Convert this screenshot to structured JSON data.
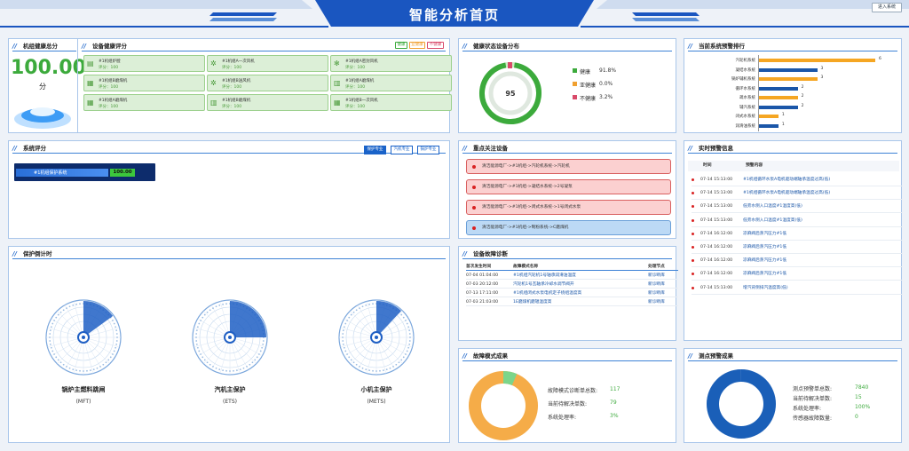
{
  "header": {
    "title": "智能分析首页",
    "button": "进入系统"
  },
  "health": {
    "title": "机组健康总分",
    "score": "100.00",
    "unit": "分"
  },
  "device": {
    "title": "设备健康评分",
    "legend": [
      {
        "label": "健康",
        "color": "#3caa3c"
      },
      {
        "label": "亚健康",
        "color": "#f0a030"
      },
      {
        "label": "不健康",
        "color": "#d94a6a"
      }
    ],
    "items": [
      {
        "name": "#1机组炉膛",
        "score": "评分：100"
      },
      {
        "name": "#1机组A一次风机",
        "score": "评分：100"
      },
      {
        "name": "#1机组A密封风机",
        "score": "评分：100"
      },
      {
        "name": "#1机组B磨煤机",
        "score": "评分：100"
      },
      {
        "name": "#1机组B送风机",
        "score": "评分：100"
      },
      {
        "name": "#1机组A磨煤机",
        "score": "评分：100"
      },
      {
        "name": "#1机组A磨煤机",
        "score": "评分：100"
      },
      {
        "name": "#1机组B磨煤机",
        "score": "评分：100"
      },
      {
        "name": "#1机组B一次风机",
        "score": "评分：100"
      }
    ]
  },
  "status_dist": {
    "title": "健康状态设备分布",
    "center": "95",
    "items": [
      {
        "label": "健康",
        "value": "91.8%",
        "color": "#3caa3c"
      },
      {
        "label": "亚健康",
        "value": "0.0%",
        "color": "#f0a030"
      },
      {
        "label": "不健康",
        "value": "3.2%",
        "color": "#d94a6a"
      }
    ]
  },
  "ranking": {
    "title": "当前系统预警排行",
    "items": [
      {
        "label": "汽轮机系统",
        "value": 6,
        "color": "#f5a623"
      },
      {
        "label": "凝结水系统",
        "value": 3,
        "color": "#1a56a8"
      },
      {
        "label": "锅炉辅机系统",
        "value": 3,
        "color": "#f5a623"
      },
      {
        "label": "循环水系统",
        "value": 2,
        "color": "#1a56a8"
      },
      {
        "label": "疏水系统",
        "value": 2,
        "color": "#f5a623"
      },
      {
        "label": "辅汽系统",
        "value": 2,
        "color": "#1a56a8"
      },
      {
        "label": "闭式水系统",
        "value": 1,
        "color": "#f5a623"
      },
      {
        "label": "润滑油系统",
        "value": 1,
        "color": "#1a56a8"
      }
    ]
  },
  "system_score": {
    "title": "系统评分",
    "tabs": [
      "保护专业",
      "汽机专业",
      "锅炉专业"
    ],
    "bar_label": "#1机组保护系统",
    "bar_value": "100.00"
  },
  "focus": {
    "title": "重点关注设备",
    "items": [
      {
        "text": "清洁能源电厂->#1机组->汽轮机系统->汽轮机",
        "bg": "#fbd0d0",
        "bd": "#d96060"
      },
      {
        "text": "清洁能源电厂->#1机组->凝结水系统->2号凝泵",
        "bg": "#fbd0d0",
        "bd": "#d96060"
      },
      {
        "text": "清洁能源电厂->#1机组->闭式水系统->1号闭式水泵",
        "bg": "#fbd0d0",
        "bd": "#d96060"
      },
      {
        "text": "清洁能源电厂->#1机组->制粉系统->C磨煤机",
        "bg": "#bcd9f5",
        "bd": "#6a9fd8"
      }
    ]
  },
  "alert": {
    "title": "实时预警信息",
    "headers": [
      "时间",
      "预警内容"
    ],
    "rows": [
      {
        "time": "07-14 15:13:00",
        "content": "#1机组循环水泵A电机驱动端轴承温度过高(低)"
      },
      {
        "time": "07-14 15:13:00",
        "content": "#1机组循环水泵A电机驱动端轴承温度过高(低)"
      },
      {
        "time": "07-14 15:13:00",
        "content": "低旁水侧入口温度#1温度高(低)"
      },
      {
        "time": "07-14 15:13:00",
        "content": "低旁水侧入口温度#1温度高(低)"
      },
      {
        "time": "07-14 16:12:00",
        "content": "凉麻阀后蒸汽压力#1低"
      },
      {
        "time": "07-14 16:12:00",
        "content": "凉麻阀后蒸汽压力#1低"
      },
      {
        "time": "07-14 16:12:00",
        "content": "凉麻阀后蒸汽压力#1低"
      },
      {
        "time": "07-14 16:12:00",
        "content": "凉麻阀后蒸汽压力#1低"
      },
      {
        "time": "07-14 15:13:00",
        "content": "增汽背侧排汽温度高(低)"
      }
    ]
  },
  "countdown": {
    "title": "保护倒计时",
    "items": [
      {
        "name": "锅炉主燃料跳闸",
        "code": "(MFT)",
        "fraction": 0.15
      },
      {
        "name": "汽机主保护",
        "code": "(ETS)",
        "fraction": 0.25
      },
      {
        "name": "小机主保护",
        "code": "(METS)",
        "fraction": 0.12
      }
    ]
  },
  "fault": {
    "title": "设备故障诊断",
    "headers": [
      "首次发生时间",
      "故障模式名称",
      "处理节点"
    ],
    "rows": [
      {
        "time": "07-04 01:04:00",
        "name": "#1机组汽轮机1号轴承润滑油温度",
        "node": "新诊断库"
      },
      {
        "time": "07-03 20:12:00",
        "name": "汽轮机1号瓦轴承冷却水调节阀开",
        "node": "新诊断库"
      },
      {
        "time": "07-13 17:11:00",
        "name": "#1机组闭式水泵电机定子绕组温度高",
        "node": "新诊断库"
      },
      {
        "time": "07-03 21:03:00",
        "name": "1E磨煤机磨辊温度高",
        "node": "新诊断库"
      }
    ]
  },
  "fault_result": {
    "title": "故障模式成果",
    "fraction": 0.064,
    "stats": [
      {
        "label": "故障模式诊断单总数:",
        "value": "117"
      },
      {
        "label": "当前待解决单数:",
        "value": "79"
      },
      {
        "label": "系统处理率:",
        "value": "3%"
      }
    ]
  },
  "measure_result": {
    "title": "测点预警成果",
    "fraction": 0.998,
    "stats": [
      {
        "label": "测点预警单总数:",
        "value": "7840"
      },
      {
        "label": "当前待解决单数:",
        "value": "15"
      },
      {
        "label": "系统处理率:",
        "value": "100%"
      },
      {
        "label": "传感器故障数量:",
        "value": "0"
      }
    ]
  }
}
